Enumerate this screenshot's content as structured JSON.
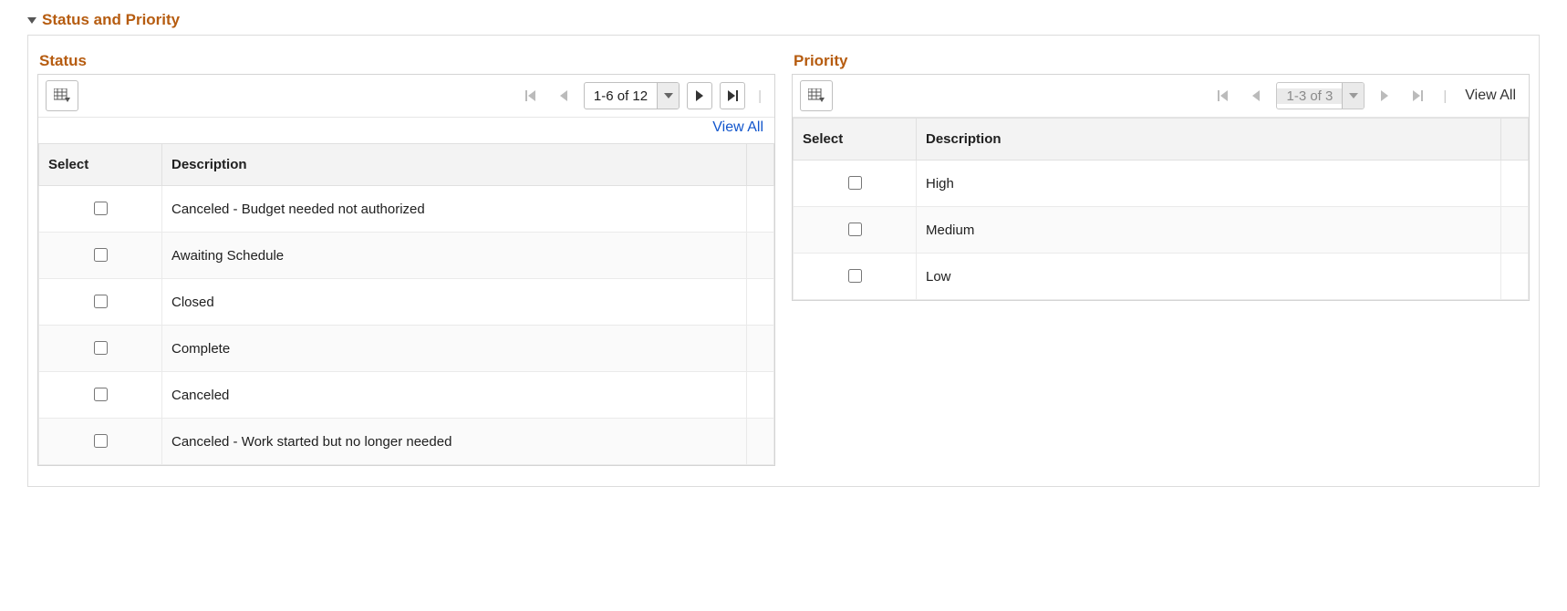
{
  "section_title": "Status and Priority",
  "status": {
    "title": "Status",
    "range": "1-6 of 12",
    "view_all": "View All",
    "columns": {
      "select": "Select",
      "description": "Description"
    },
    "rows": [
      {
        "description": "Canceled - Budget needed not authorized"
      },
      {
        "description": "Awaiting Schedule"
      },
      {
        "description": "Closed"
      },
      {
        "description": "Complete"
      },
      {
        "description": "Canceled"
      },
      {
        "description": "Canceled - Work started but no longer needed"
      }
    ]
  },
  "priority": {
    "title": "Priority",
    "range": "1-3 of 3",
    "view_all": "View All",
    "columns": {
      "select": "Select",
      "description": "Description"
    },
    "rows": [
      {
        "description": "High"
      },
      {
        "description": "Medium"
      },
      {
        "description": "Low"
      }
    ]
  }
}
